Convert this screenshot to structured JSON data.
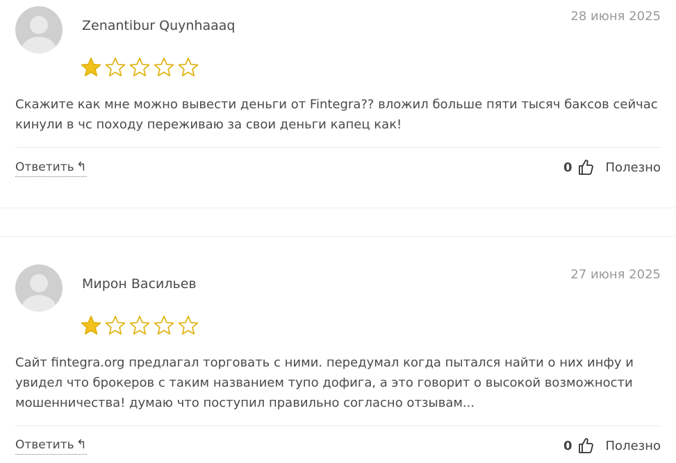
{
  "reviews": [
    {
      "author": "Zenantibur Quynhaaaq",
      "date": "28 июня 2025",
      "rating": 1,
      "max_rating": 5,
      "text": "Скажите как мне можно вывести деньги от Fintegra?? вложил больше пяти тысяч баксов сейчас кинули в чс походу переживаю за свои деньги капец как!",
      "reply_label": "Ответить",
      "reply_icon": "↰",
      "helpful_count": "0",
      "helpful_label": "Полезно"
    },
    {
      "author": "Мирон Васильев",
      "date": "27 июня 2025",
      "rating": 1,
      "max_rating": 5,
      "text": "Сайт fintegra.org предлагал торговать с ними. передумал когда пытался найти о них инфу и увидел что брокеров с таким названием тупо дофига, а это говорит о высокой возможности мошенничества! думаю что поступил правильно согласно отзывам...",
      "reply_label": "Ответить",
      "reply_icon": "↰",
      "helpful_count": "0",
      "helpful_label": "Полезно"
    }
  ],
  "colors": {
    "star_filled": "#F2C21B",
    "star_stroke": "#E0B20F",
    "avatar_bg": "#CFCFCF",
    "avatar_fg": "#E9E9E9"
  },
  "icons": {
    "avatar": "default-user-avatar-icon",
    "star": "star-icon",
    "reply": "reply-arrow-icon",
    "thumb": "thumbs-up-icon"
  }
}
